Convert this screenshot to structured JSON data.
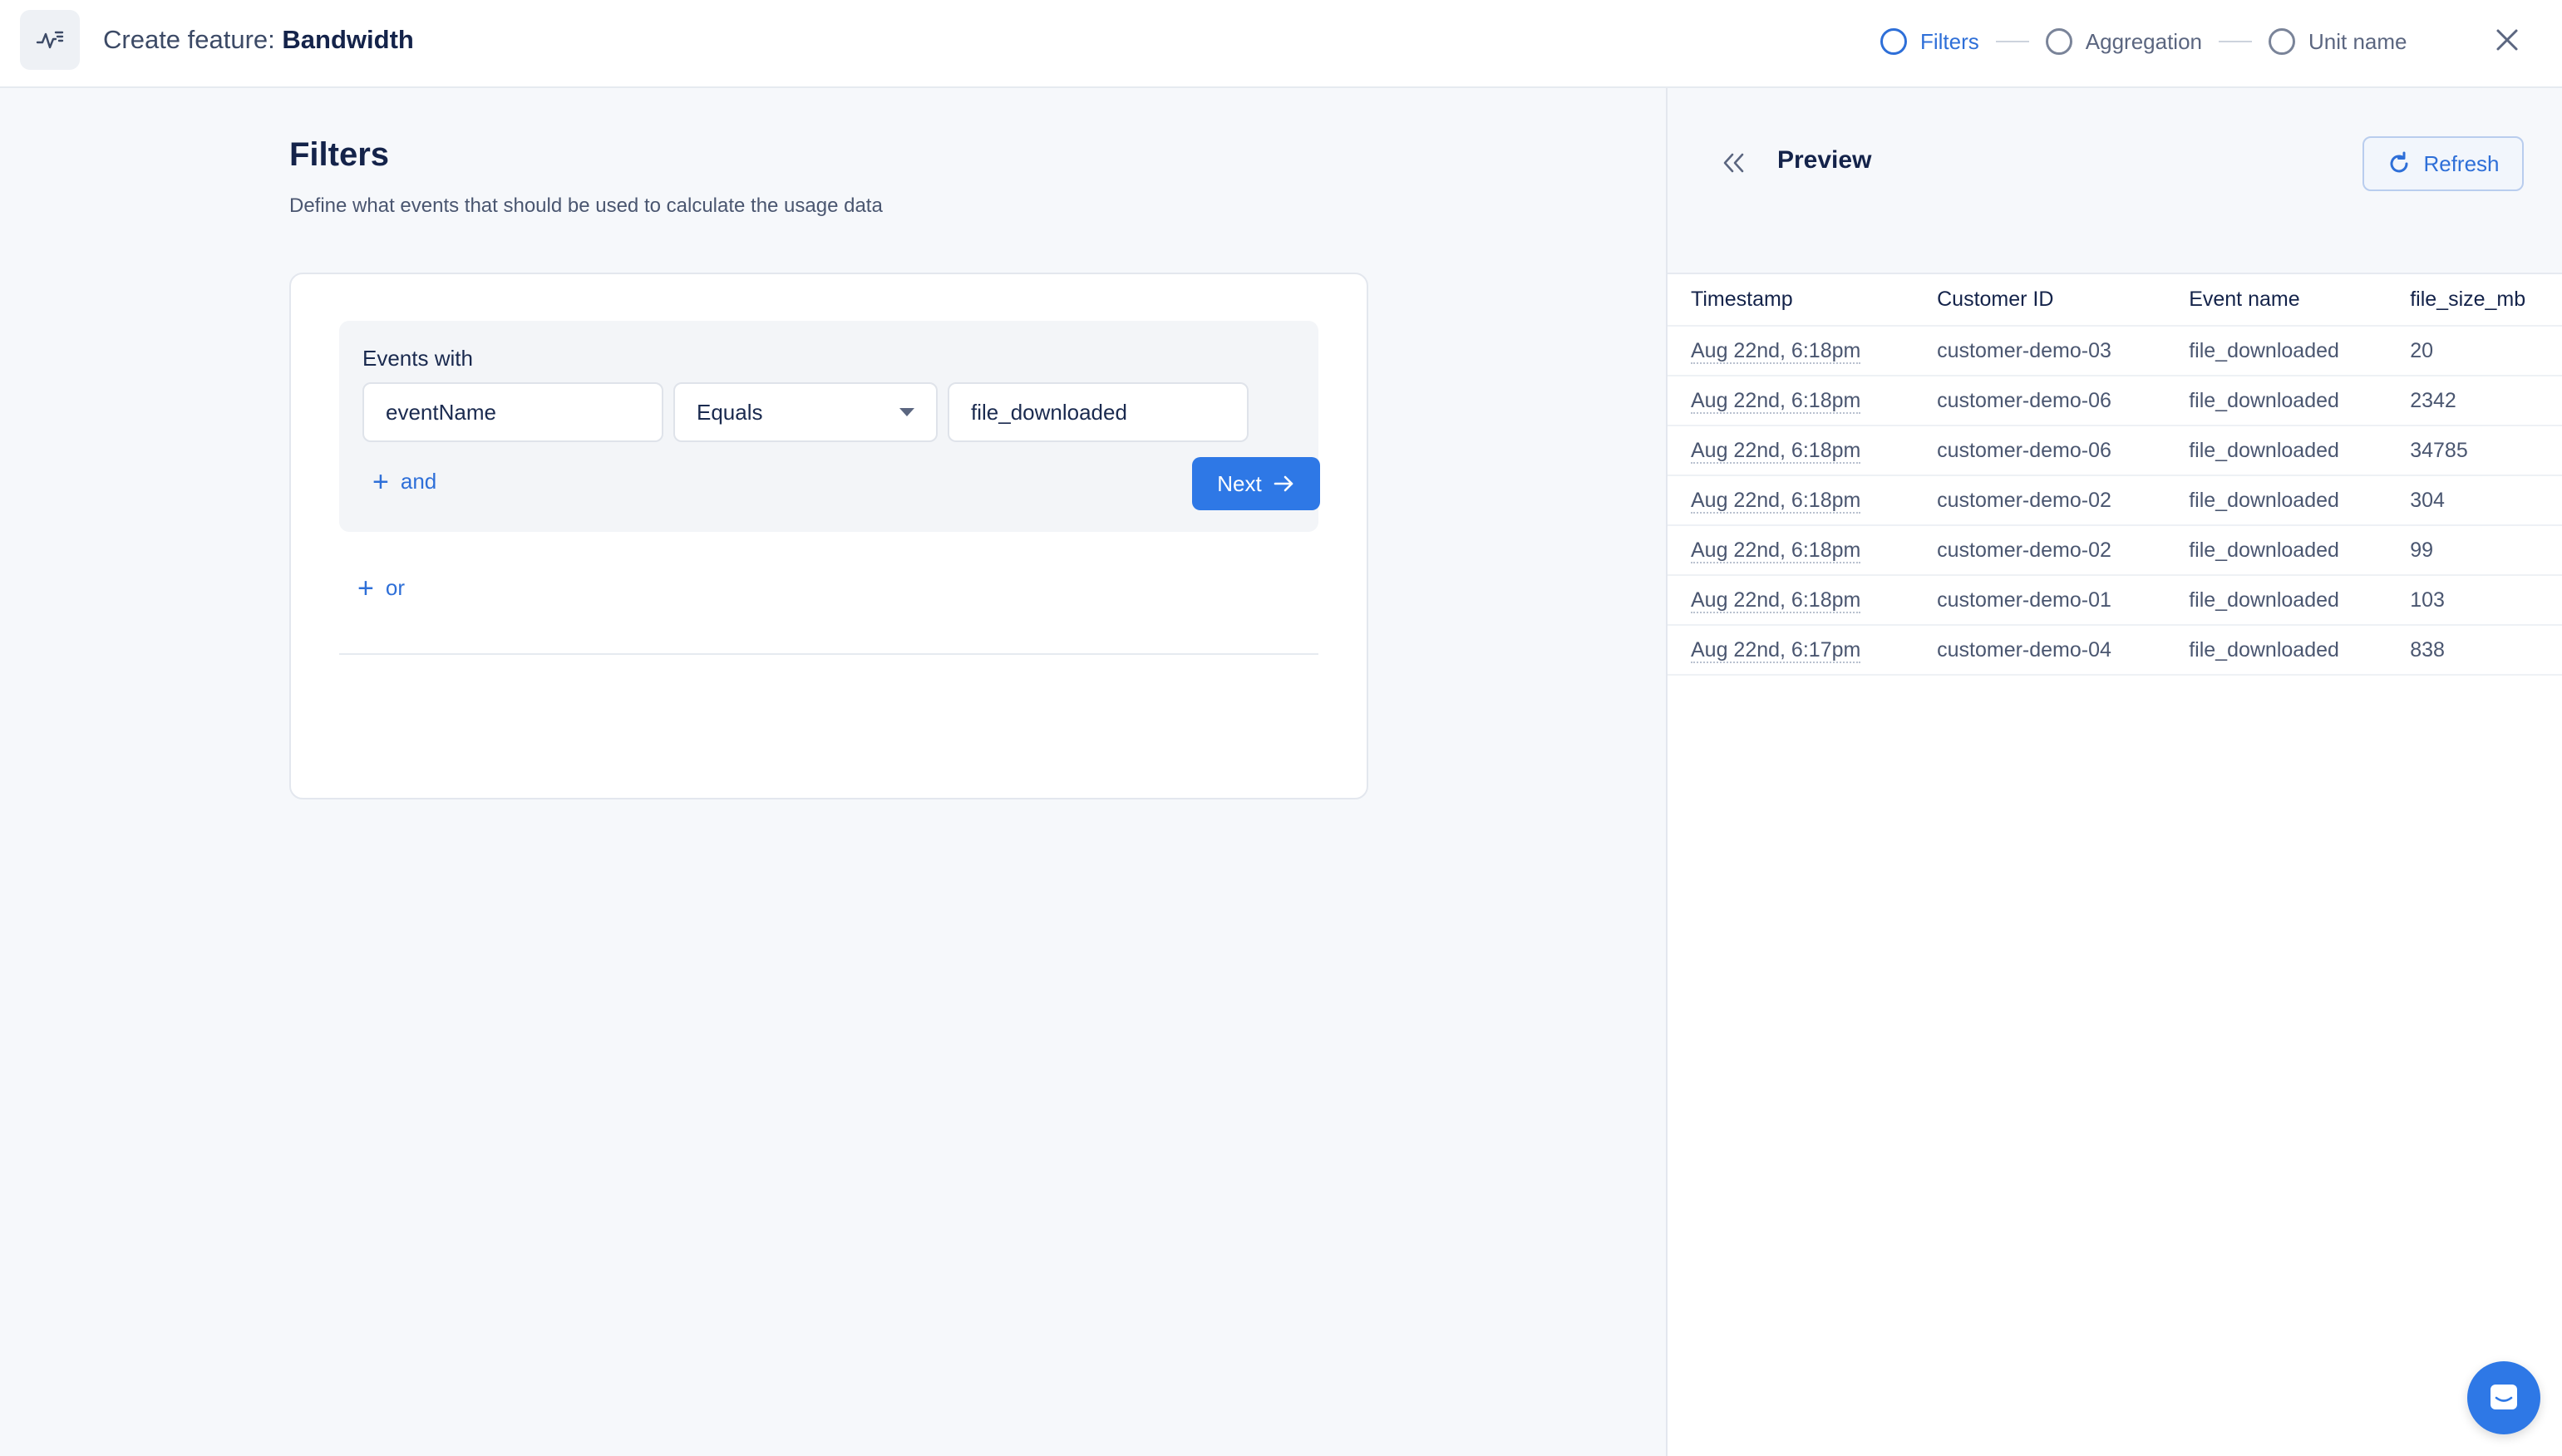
{
  "header": {
    "title_prefix": "Create feature:",
    "title_name": "Bandwidth",
    "steps": [
      {
        "label": "Filters",
        "active": true
      },
      {
        "label": "Aggregation",
        "active": false
      },
      {
        "label": "Unit name",
        "active": false
      }
    ]
  },
  "filters": {
    "title": "Filters",
    "subtitle": "Define what events that should be used to calculate the usage data",
    "group_label": "Events with",
    "field_value": "eventName",
    "operator_value": "Equals",
    "match_value": "file_downloaded",
    "add_and_label": "and",
    "add_or_label": "or",
    "next_label": "Next"
  },
  "preview": {
    "title": "Preview",
    "refresh_label": "Refresh",
    "columns": [
      "Timestamp",
      "Customer ID",
      "Event name",
      "file_size_mb"
    ],
    "rows": [
      [
        "Aug 22nd, 6:18pm",
        "customer-demo-03",
        "file_downloaded",
        "20"
      ],
      [
        "Aug 22nd, 6:18pm",
        "customer-demo-06",
        "file_downloaded",
        "2342"
      ],
      [
        "Aug 22nd, 6:18pm",
        "customer-demo-06",
        "file_downloaded",
        "34785"
      ],
      [
        "Aug 22nd, 6:18pm",
        "customer-demo-02",
        "file_downloaded",
        "304"
      ],
      [
        "Aug 22nd, 6:18pm",
        "customer-demo-02",
        "file_downloaded",
        "99"
      ],
      [
        "Aug 22nd, 6:18pm",
        "customer-demo-01",
        "file_downloaded",
        "103"
      ],
      [
        "Aug 22nd, 6:17pm",
        "customer-demo-04",
        "file_downloaded",
        "838"
      ]
    ]
  },
  "colors": {
    "accent": "#2e78e6",
    "text_dark": "#14234a",
    "background": "#f6f8fb"
  },
  "icons": {
    "app": "activity-chart-icon",
    "close": "close-icon",
    "collapse": "chevrons-left-icon",
    "refresh": "refresh-icon",
    "next": "arrow-right-icon",
    "chat": "chat-icon"
  }
}
